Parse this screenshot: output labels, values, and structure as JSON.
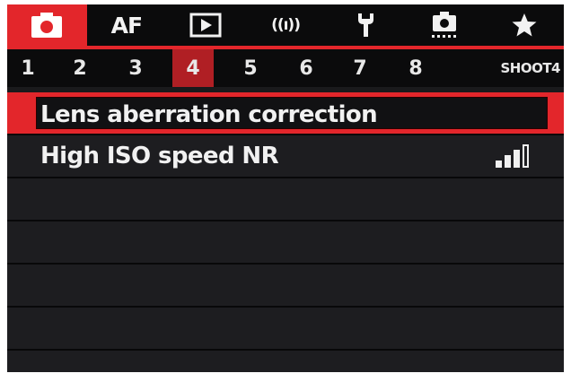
{
  "categories": [
    {
      "name": "tab-shoot",
      "label": "",
      "icon": "camera-icon",
      "active": true
    },
    {
      "name": "tab-af",
      "label": "AF",
      "icon": "",
      "active": false
    },
    {
      "name": "tab-playback",
      "label": "",
      "icon": "play-icon",
      "active": false
    },
    {
      "name": "tab-wireless",
      "label": "((ı))",
      "icon": "wireless-icon",
      "active": false
    },
    {
      "name": "tab-setup",
      "label": "",
      "icon": "wrench-icon",
      "active": false
    },
    {
      "name": "tab-custom",
      "label": "",
      "icon": "custom-camera-icon",
      "active": false
    },
    {
      "name": "tab-mymenu",
      "label": "",
      "icon": "star-icon",
      "active": false
    }
  ],
  "pages": {
    "numbers": [
      "1",
      "2",
      "3",
      "4",
      "5",
      "6",
      "7",
      "8"
    ],
    "active_index": 3,
    "current_name": "SHOOT4"
  },
  "menu": {
    "items": [
      {
        "label": "Lens aberration correction",
        "selected": true
      },
      {
        "label": "High ISO speed NR",
        "selected": false,
        "value_icon": "nr-level-icon",
        "nr_level": 3,
        "nr_max": 4
      }
    ],
    "empty_rows": 5
  },
  "colors": {
    "accent": "#e3262b",
    "active_page": "#b01f24",
    "background": "#1d1d20"
  }
}
